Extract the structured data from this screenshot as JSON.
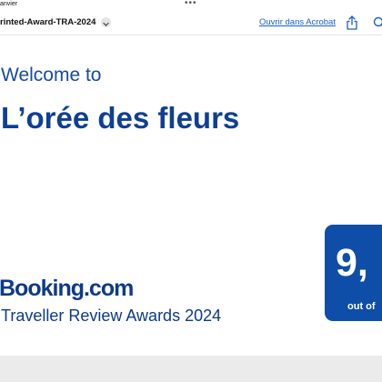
{
  "status_bar": {
    "date_text": "anvier",
    "dots": "•••"
  },
  "toolbar": {
    "filename": "rinted-Award-TRA-2024",
    "open_in_acrobat": "Ouvrir dans Acrobat",
    "share_icon": "share-icon",
    "search_icon": "search-icon"
  },
  "document": {
    "welcome": "Welcome to",
    "venue_name": "L’orée des fleurs",
    "brand": "Booking.com",
    "award_title": "Traveller Review Awards 2024",
    "score": "9,",
    "score_suffix": "out of"
  },
  "colors": {
    "brand_blue": "#0e3a89",
    "card_blue": "#0e4ea8",
    "link_blue": "#1a5fd0"
  }
}
